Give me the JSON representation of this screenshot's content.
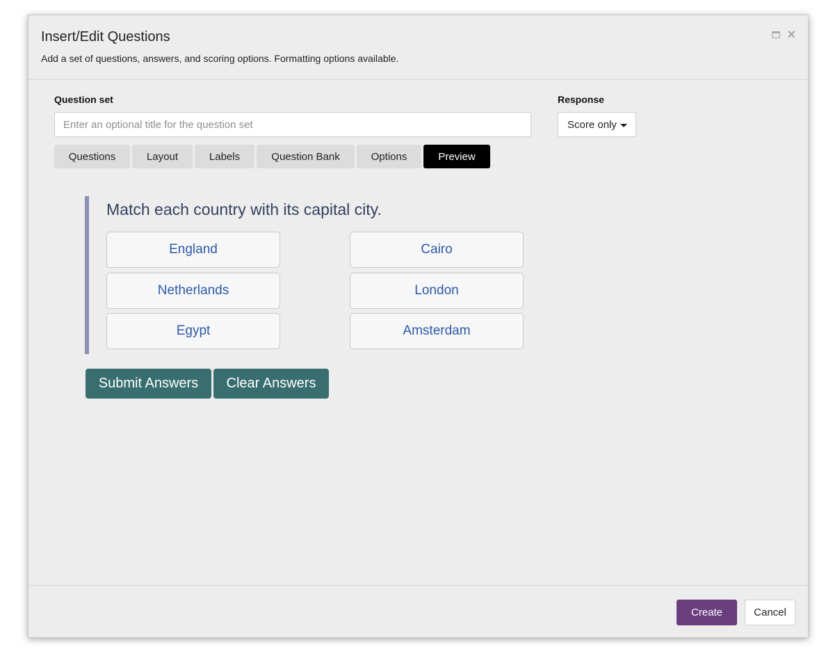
{
  "dialog": {
    "title": "Insert/Edit Questions",
    "subtitle": "Add a set of questions, answers, and scoring options. Formatting options available."
  },
  "question_set": {
    "label": "Question set",
    "value": "",
    "placeholder": "Enter an optional title for the question set"
  },
  "response": {
    "label": "Response",
    "selected": "Score only"
  },
  "tabs": [
    {
      "label": "Questions",
      "active": false
    },
    {
      "label": "Layout",
      "active": false
    },
    {
      "label": "Labels",
      "active": false
    },
    {
      "label": "Question Bank",
      "active": false
    },
    {
      "label": "Options",
      "active": false
    },
    {
      "label": "Preview",
      "active": true
    }
  ],
  "preview": {
    "prompt": "Match each country with its capital city.",
    "left_items": [
      "England",
      "Netherlands",
      "Egypt"
    ],
    "right_items": [
      "Cairo",
      "London",
      "Amsterdam"
    ],
    "submit_label": "Submit Answers",
    "clear_label": "Clear Answers"
  },
  "footer": {
    "create_label": "Create",
    "cancel_label": "Cancel"
  },
  "colors": {
    "accent_purple": "#6a3e7f",
    "action_teal": "#386e6f",
    "tab_active": "#000000",
    "match_text": "#2d59a8",
    "quote_bar": "#8a91b6"
  },
  "icons": [
    "maximize-icon",
    "close-icon",
    "caret-down-icon"
  ]
}
